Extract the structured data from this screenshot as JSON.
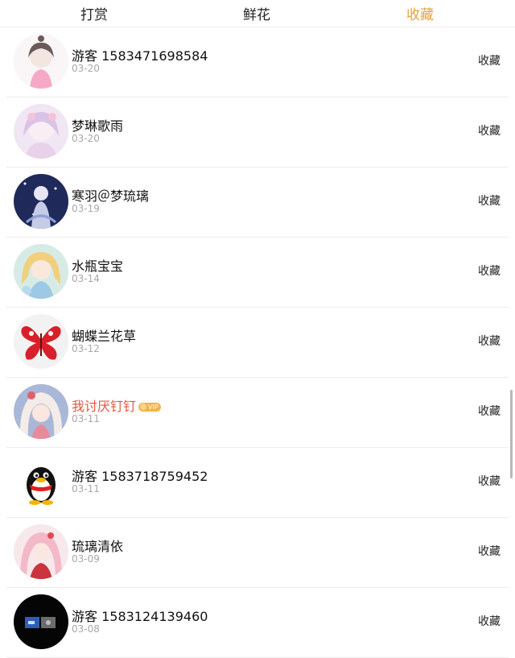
{
  "colors": {
    "accent": "#e8a23a",
    "vip": "#e8553f"
  },
  "tabs": [
    {
      "label": "打赏",
      "active": false
    },
    {
      "label": "鲜花",
      "active": false
    },
    {
      "label": "收藏",
      "active": true
    }
  ],
  "rows": [
    {
      "name": "游客 1583471698584",
      "date": "03-20",
      "action": "收藏",
      "vip": false,
      "avatar": "girl-sketch-avatar"
    },
    {
      "name": "梦琳歌雨",
      "date": "03-20",
      "action": "收藏",
      "vip": false,
      "avatar": "pastel-anime-avatar"
    },
    {
      "name": "寒羽＠梦琉璃",
      "date": "03-19",
      "action": "收藏",
      "vip": false,
      "avatar": "night-sky-avatar"
    },
    {
      "name": "水瓶宝宝",
      "date": "03-14",
      "action": "收藏",
      "vip": false,
      "avatar": "blonde-anime-avatar"
    },
    {
      "name": "蝴蝶兰花草",
      "date": "03-12",
      "action": "收藏",
      "vip": false,
      "avatar": "red-butterfly-avatar"
    },
    {
      "name": "我讨厌钉钉",
      "date": "03-11",
      "action": "收藏",
      "vip": true,
      "vip_badge": "VIP",
      "avatar": "pink-anime-avatar"
    },
    {
      "name": "游客 1583718759452",
      "date": "03-11",
      "action": "收藏",
      "vip": false,
      "avatar": "penguin-avatar"
    },
    {
      "name": "琉璃清依",
      "date": "03-09",
      "action": "收藏",
      "vip": false,
      "avatar": "kimono-anime-avatar"
    },
    {
      "name": "游客 1583124139460",
      "date": "03-08",
      "action": "收藏",
      "vip": false,
      "avatar": "dark-photo-avatar"
    }
  ]
}
